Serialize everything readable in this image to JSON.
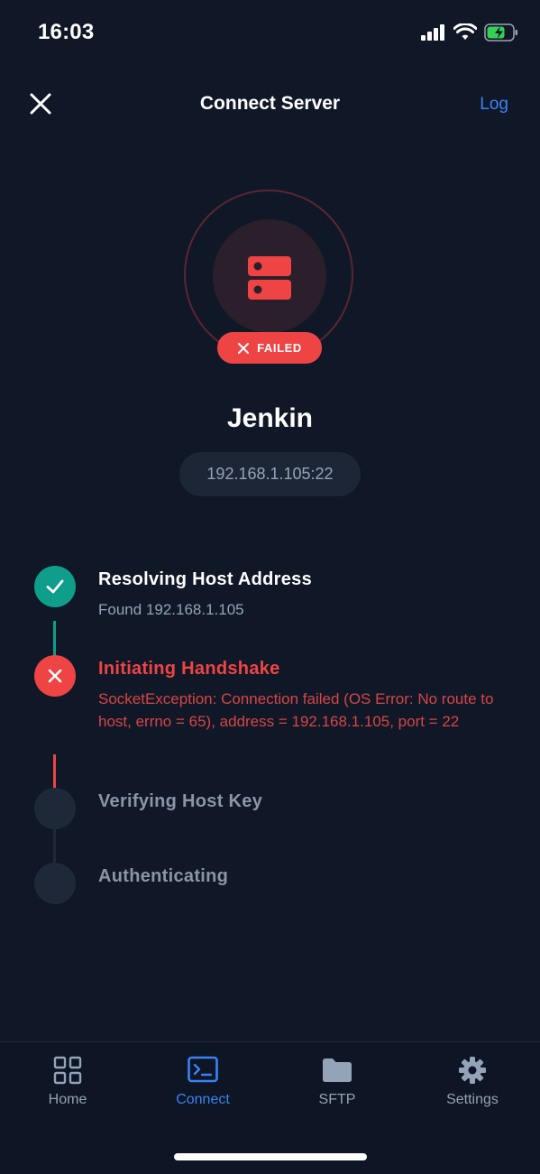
{
  "status_bar": {
    "time": "16:03"
  },
  "header": {
    "title": "Connect Server",
    "log_label": "Log"
  },
  "server": {
    "status_badge": "FAILED",
    "name": "Jenkin",
    "address": "192.168.1.105:22"
  },
  "steps": [
    {
      "title": "Resolving Host Address",
      "detail": "Found 192.168.1.105",
      "state": "success"
    },
    {
      "title": "Initiating Handshake",
      "detail": "SocketException: Connection failed (OS Error: No route to host, errno = 65), address = 192.168.1.105, port = 22",
      "state": "error"
    },
    {
      "title": "Verifying Host Key",
      "detail": "",
      "state": "pending"
    },
    {
      "title": "Authenticating",
      "detail": "",
      "state": "pending"
    }
  ],
  "tabs": [
    {
      "label": "Home",
      "icon": "grid-icon"
    },
    {
      "label": "Connect",
      "icon": "terminal-icon",
      "active": true
    },
    {
      "label": "SFTP",
      "icon": "folder-icon"
    },
    {
      "label": "Settings",
      "icon": "gear-icon"
    }
  ],
  "colors": {
    "background": "#101828",
    "accent": "#3b82f6",
    "success": "#0f9e8a",
    "error": "#ef4444",
    "muted": "#94a3b8"
  }
}
